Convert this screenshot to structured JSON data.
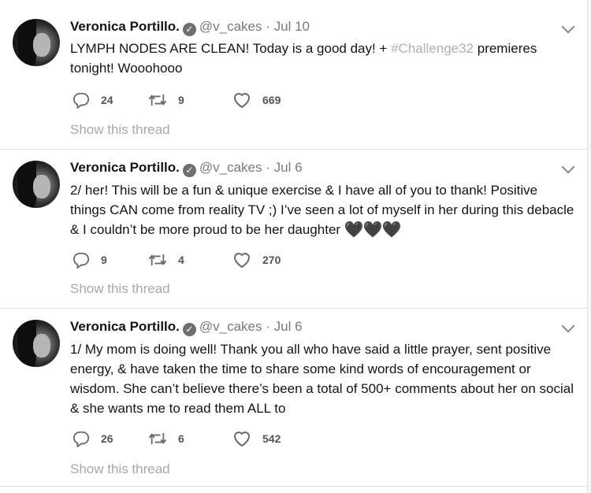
{
  "tweets": [
    {
      "name": "Veronica Portillo.",
      "handle": "@v_cakes",
      "separator": "·",
      "date": "Jul 10",
      "text_main": "LYMPH NODES ARE CLEAN!  Today is a good day!  + ",
      "hashtag": "#Challenge32",
      "text_after": " premieres tonight!  Wooohooo",
      "hearts": "",
      "replies": "24",
      "retweets": "9",
      "likes": "669",
      "show_thread": "Show this thread"
    },
    {
      "name": "Veronica Portillo.",
      "handle": "@v_cakes",
      "separator": "·",
      "date": "Jul 6",
      "text_main": "2/ her! This will be a fun & unique exercise & I have all of you to thank!   Positive things CAN come from reality TV ;)  I’ve seen a lot of myself in her during this debacle & I couldn’t be more proud to be her daughter ",
      "hashtag": "",
      "text_after": "",
      "hearts": "🖤🖤🖤",
      "replies": "9",
      "retweets": "4",
      "likes": "270",
      "show_thread": "Show this thread"
    },
    {
      "name": "Veronica Portillo.",
      "handle": "@v_cakes",
      "separator": "·",
      "date": "Jul 6",
      "text_main": "1/ My mom is doing well! Thank you all who have said a little prayer, sent positive energy, & have taken the time to share some kind words of encouragement or wisdom. She can’t believe there’s been a total of 500+ comments about her on social & she wants me to read them ALL to",
      "hashtag": "",
      "text_after": "",
      "hearts": "",
      "replies": "26",
      "retweets": "6",
      "likes": "542",
      "show_thread": "Show this thread"
    }
  ],
  "icons": {
    "verified": "verified-badge-icon",
    "reply": "reply-icon",
    "retweet": "retweet-icon",
    "like": "heart-icon",
    "menu": "chevron-down-icon"
  },
  "colors": {
    "text": "#141414",
    "muted": "#7a7a7a",
    "hashtag": "#b0b0b0",
    "thread_link": "#a8a8a8"
  }
}
